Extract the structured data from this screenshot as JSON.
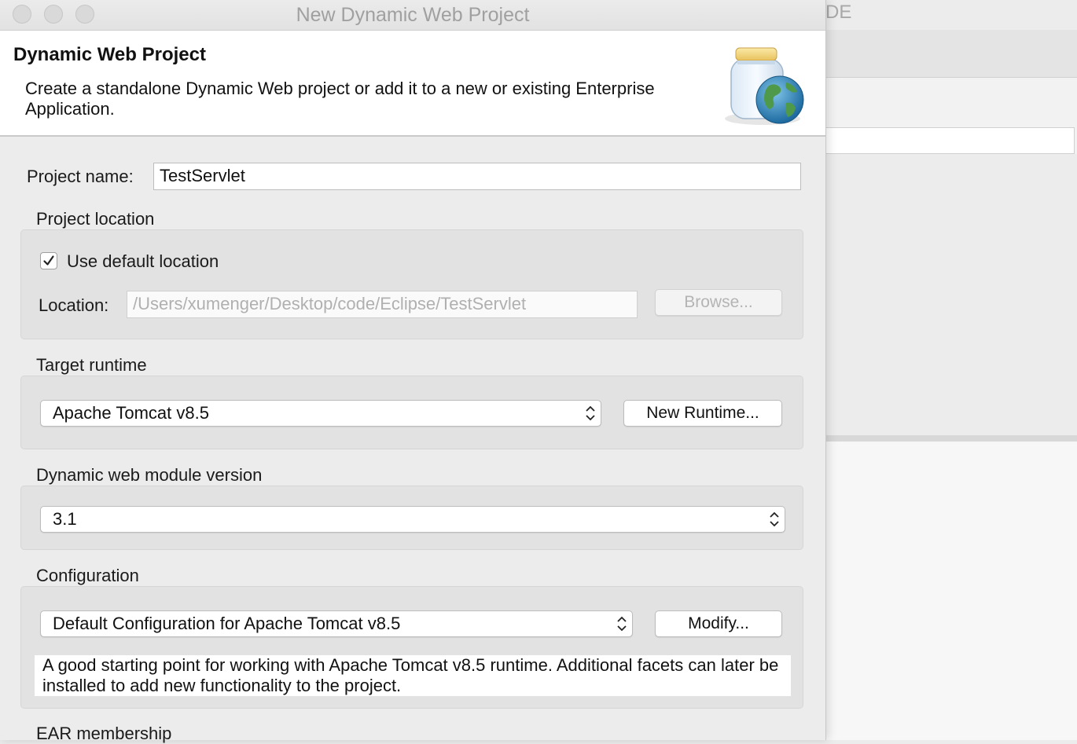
{
  "window": {
    "title": "New Dynamic Web Project"
  },
  "background_window": {
    "title_fragment": "DE"
  },
  "header": {
    "title": "Dynamic Web Project",
    "description": "Create a standalone Dynamic Web project or add it to a new or existing Enterprise Application.",
    "icon": "jar-globe-icon"
  },
  "project_name": {
    "label": "Project name:",
    "value": "TestServlet"
  },
  "project_location": {
    "section_label": "Project location",
    "use_default_label": "Use default location",
    "use_default_checked": true,
    "location_label": "Location:",
    "location_value": "/Users/xumenger/Desktop/code/Eclipse/TestServlet",
    "browse_label": "Browse..."
  },
  "target_runtime": {
    "section_label": "Target runtime",
    "selected": "Apache Tomcat v8.5",
    "new_runtime_label": "New Runtime..."
  },
  "module_version": {
    "section_label": "Dynamic web module version",
    "selected": "3.1"
  },
  "configuration": {
    "section_label": "Configuration",
    "selected": "Default Configuration for Apache Tomcat v8.5",
    "modify_label": "Modify...",
    "description": "A good starting point for working with Apache Tomcat v8.5 runtime. Additional facets can later be installed to add new functionality to the project."
  },
  "ear_membership": {
    "section_label": "EAR membership"
  },
  "colors": {
    "panel_bg": "#ececec",
    "group_bg": "#e2e2e2",
    "header_bg": "#ffffff",
    "disabled_text": "#b0b0b0"
  }
}
